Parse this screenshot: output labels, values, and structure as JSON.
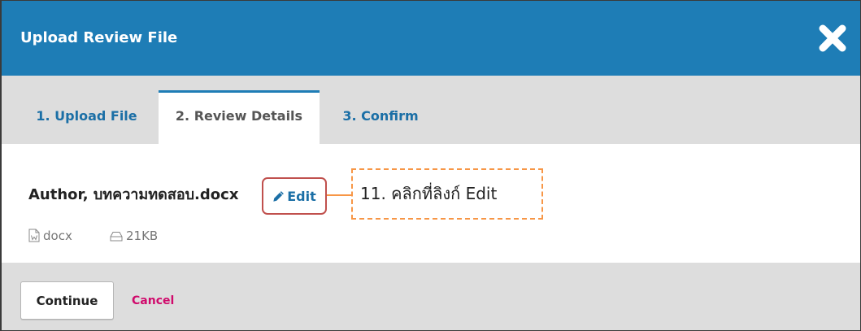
{
  "colors": {
    "header_bg": "#1e7db6",
    "link": "#1b6fa6",
    "tab_active_text": "#555555",
    "bar_bg": "#dddddd",
    "cancel": "#d00a6c",
    "annotation_highlight": "#c0504d",
    "annotation_callout": "#f79646",
    "meta_text": "#777777"
  },
  "dialog": {
    "title": "Upload Review File",
    "close_icon": "close-icon"
  },
  "tabs": [
    {
      "label": "1. Upload File",
      "active": false
    },
    {
      "label": "2. Review Details",
      "active": true
    },
    {
      "label": "3. Confirm",
      "active": false
    }
  ],
  "file": {
    "name": "Author, บทความทดสอบ.docx",
    "edit": {
      "label": "Edit",
      "icon": "pencil-icon"
    },
    "type": {
      "label": "docx",
      "icon": "word-document-icon"
    },
    "size": {
      "label": "21KB",
      "icon": "hard-drive-icon"
    }
  },
  "annotation": {
    "callout_text": "11. คลิกที่ลิงก์ Edit"
  },
  "footer": {
    "continue_label": "Continue",
    "cancel_label": "Cancel"
  }
}
